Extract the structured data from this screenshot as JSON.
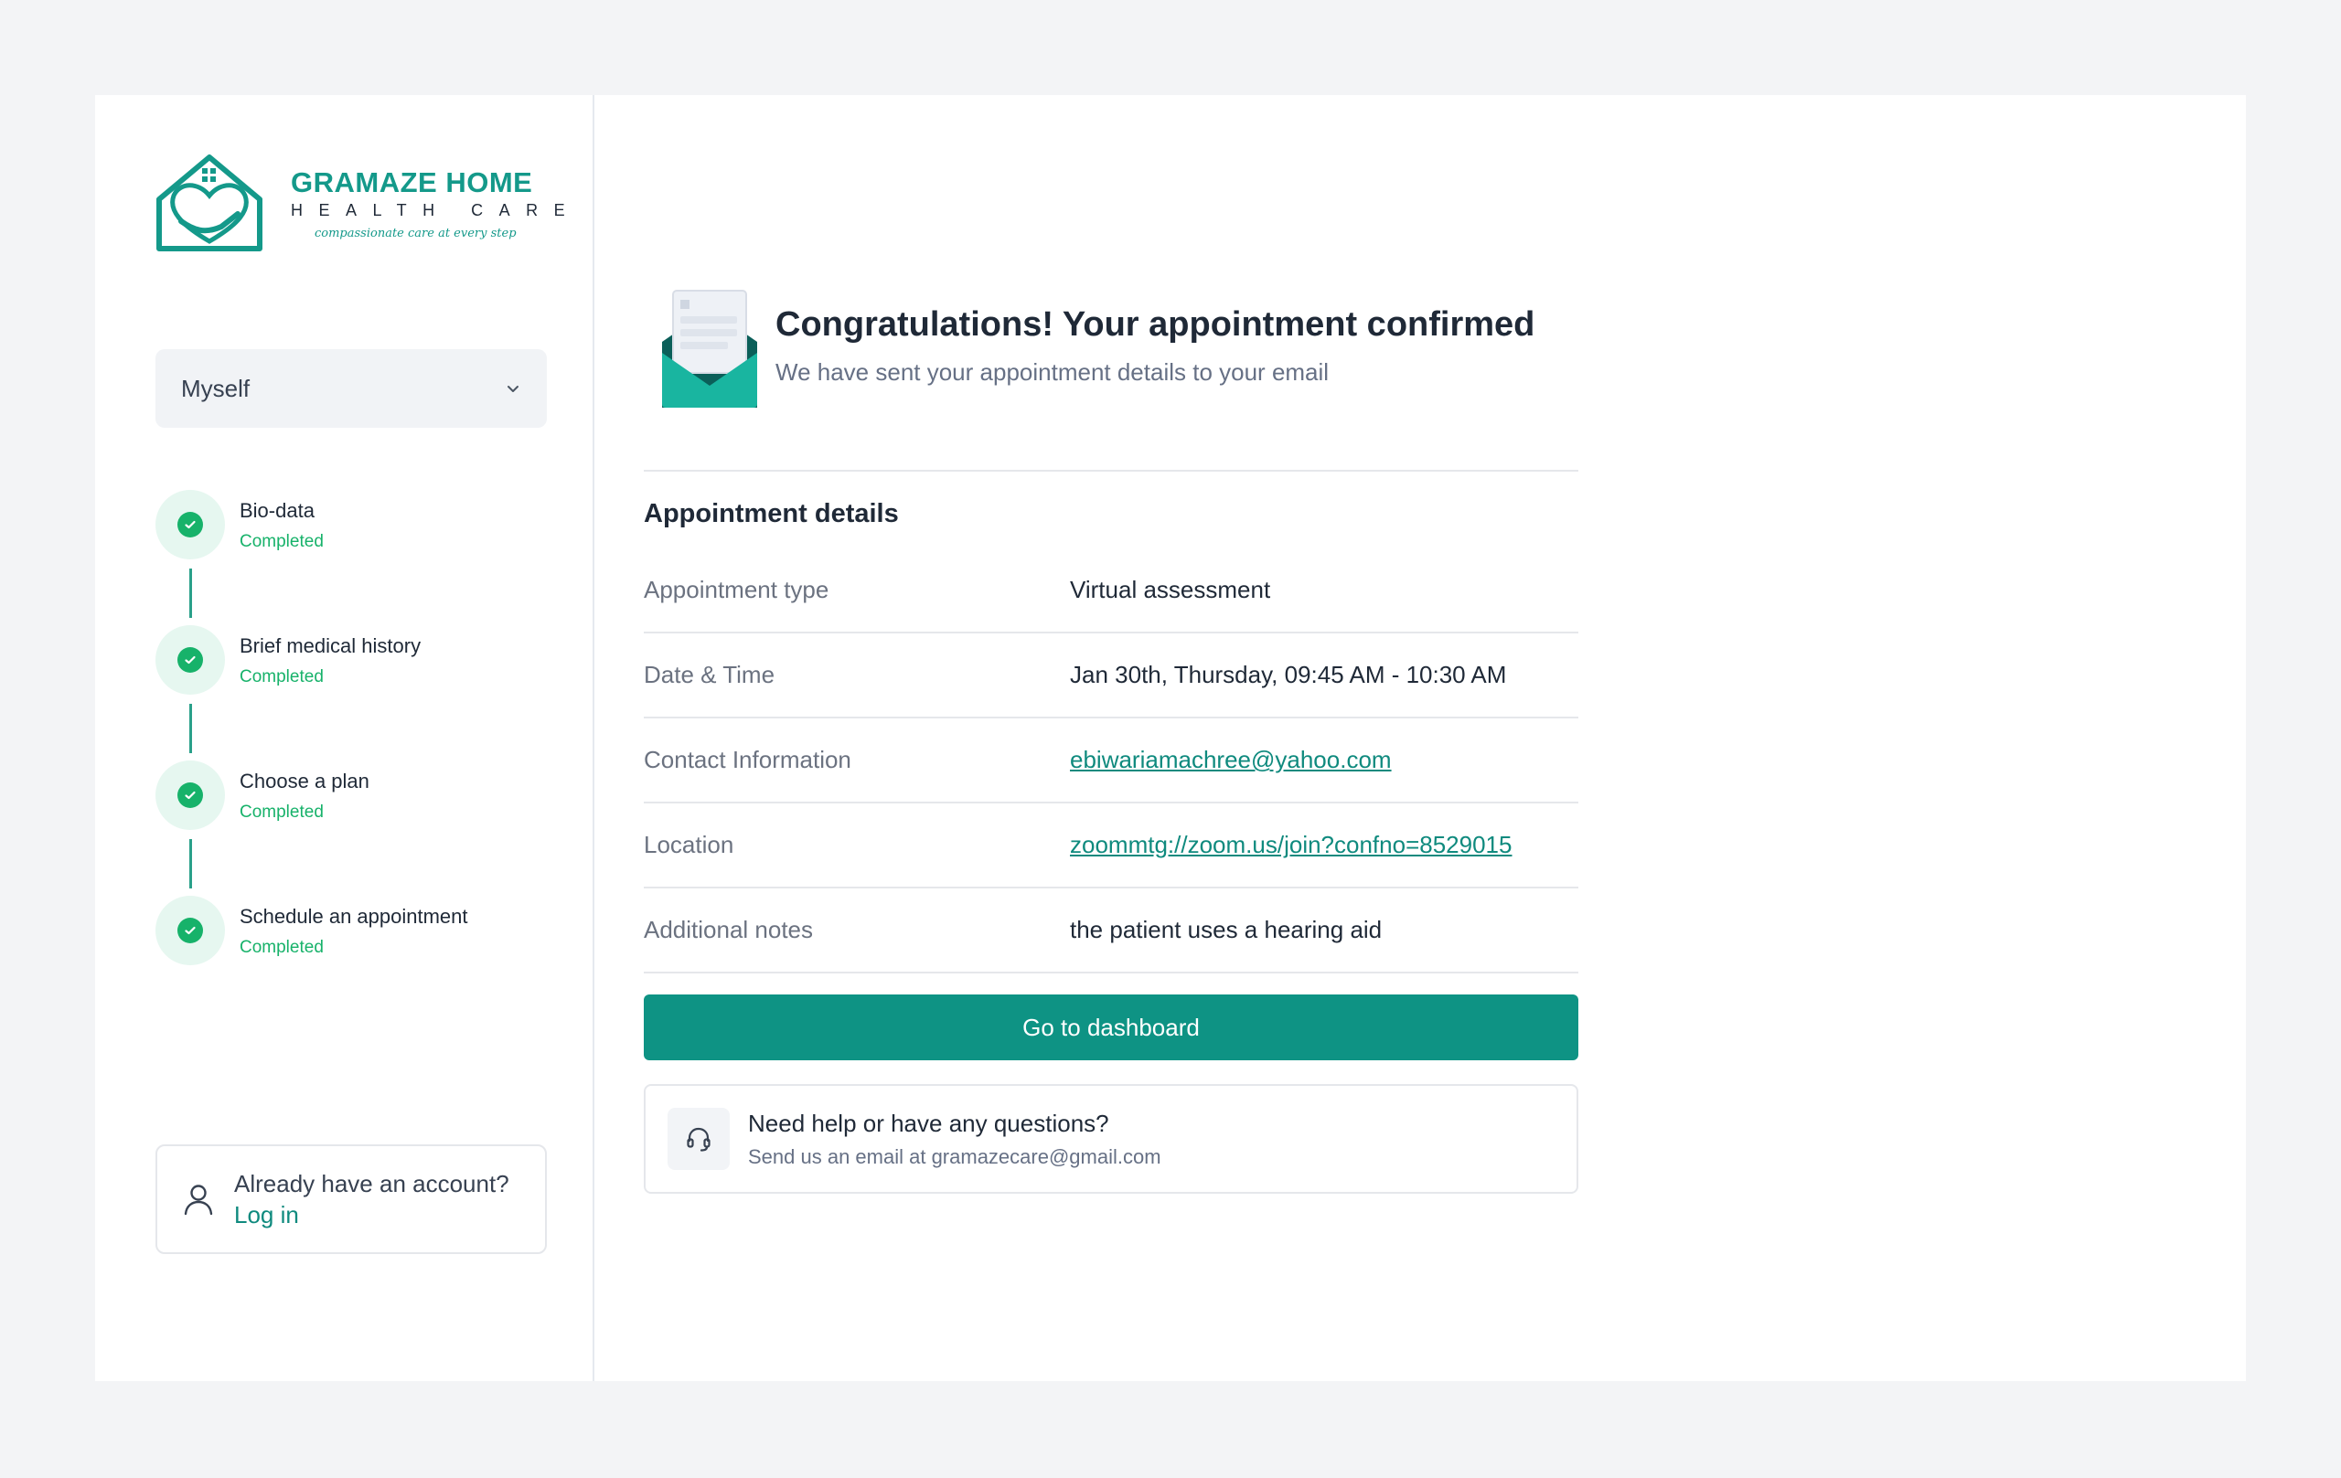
{
  "brand": {
    "name": "GRAMAZE HOME",
    "sub": "HEALTH CARE",
    "tagline": "compassionate care at every step",
    "accent": "#14998a"
  },
  "selector": {
    "value": "Myself",
    "icon": "chevron-down-icon"
  },
  "steps": [
    {
      "title": "Bio-data",
      "status": "Completed"
    },
    {
      "title": "Brief medical history",
      "status": "Completed"
    },
    {
      "title": "Choose a plan",
      "status": "Completed"
    },
    {
      "title": "Schedule an appointment",
      "status": "Completed"
    }
  ],
  "account": {
    "question": "Already have an account?",
    "link": "Log in",
    "icon": "user-icon"
  },
  "confirmation": {
    "title": "Congratulations! Your appointment confirmed",
    "subtitle": "We have sent your appointment details to your email",
    "icon": "envelope-icon"
  },
  "details": {
    "heading": "Appointment details",
    "rows": [
      {
        "label": "Appointment type",
        "value": "Virtual assessment"
      },
      {
        "label": "Date & Time",
        "value": "Jan 30th, Thursday, 09:45 AM - 10:30 AM"
      },
      {
        "label": "Contact Information",
        "value": "ebiwariamachree@yahoo.com"
      },
      {
        "label": "Location",
        "value": "zoommtg://zoom.us/join?confno=8529015"
      },
      {
        "label": "Additional notes",
        "value": "the patient uses a hearing aid"
      }
    ]
  },
  "actions": {
    "dashboard": "Go to dashboard"
  },
  "help": {
    "title": "Need help or have any questions?",
    "subtitle": "Send us an email at gramazecare@gmail.com",
    "icon": "headset-icon"
  },
  "colors": {
    "primary": "#0e9384",
    "success": "#17b26a",
    "background": "#f3f4f6"
  }
}
